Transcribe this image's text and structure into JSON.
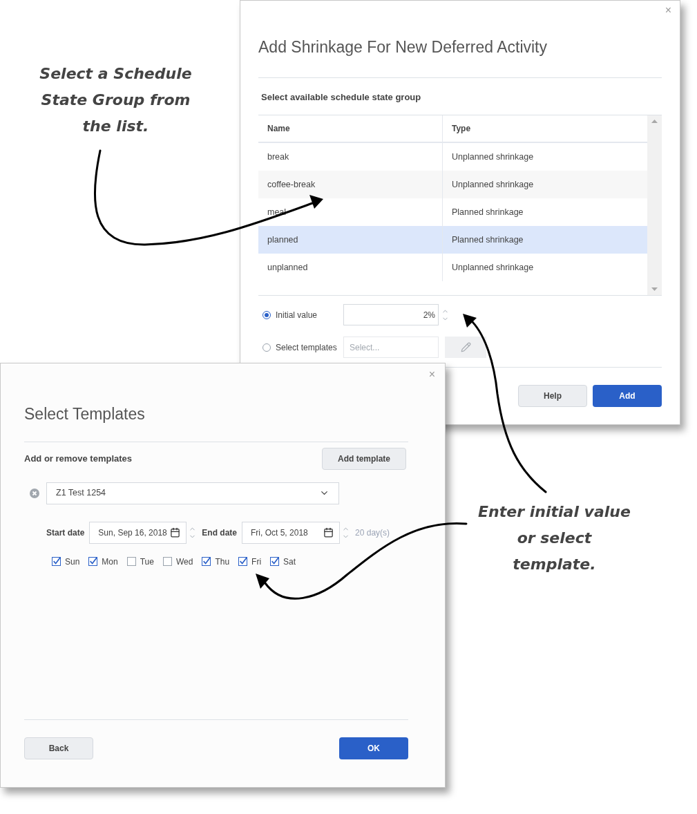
{
  "shrinkage_dialog": {
    "close": "×",
    "title": "Add Shrinkage For New Deferred Activity",
    "section_label": "Select available schedule state group",
    "table": {
      "columns": [
        "Name",
        "Type"
      ],
      "rows": [
        {
          "name": "break",
          "type": "Unplanned shrinkage",
          "selected": false
        },
        {
          "name": "coffee-break",
          "type": "Unplanned shrinkage",
          "selected": false
        },
        {
          "name": "meal",
          "type": "Planned shrinkage",
          "selected": false
        },
        {
          "name": "planned",
          "type": "Planned shrinkage",
          "selected": true
        },
        {
          "name": "unplanned",
          "type": "Unplanned shrinkage",
          "selected": false
        }
      ]
    },
    "options": [
      {
        "label": "Initial value",
        "selected": true,
        "kind": "value",
        "value": "2%"
      },
      {
        "label": "Select templates",
        "selected": false,
        "kind": "template",
        "placeholder": "Select..."
      }
    ],
    "buttons": [
      {
        "label": "Help",
        "primary": false
      },
      {
        "label": "Add",
        "primary": true
      }
    ]
  },
  "templates_dialog": {
    "close": "×",
    "title": "Select Templates",
    "section_label": "Add or remove templates",
    "add_button": "Add template",
    "template": {
      "value": "Z1 Test 1254",
      "start_label": "Start date",
      "start_value": "Sun, Sep 16, 2018",
      "end_label": "End date",
      "end_value": "Fri, Oct 5, 2018",
      "duration": "20 day(s)",
      "days": [
        {
          "label": "Sun",
          "checked": true
        },
        {
          "label": "Mon",
          "checked": true
        },
        {
          "label": "Tue",
          "checked": false
        },
        {
          "label": "Wed",
          "checked": false
        },
        {
          "label": "Thu",
          "checked": true
        },
        {
          "label": "Fri",
          "checked": true
        },
        {
          "label": "Sat",
          "checked": true
        }
      ]
    },
    "buttons": [
      {
        "label": "Back",
        "primary": false
      },
      {
        "label": "OK",
        "primary": true
      }
    ]
  },
  "callouts": [
    "Select a Schedule State Group from the list.",
    "Enter initial value or select template."
  ]
}
